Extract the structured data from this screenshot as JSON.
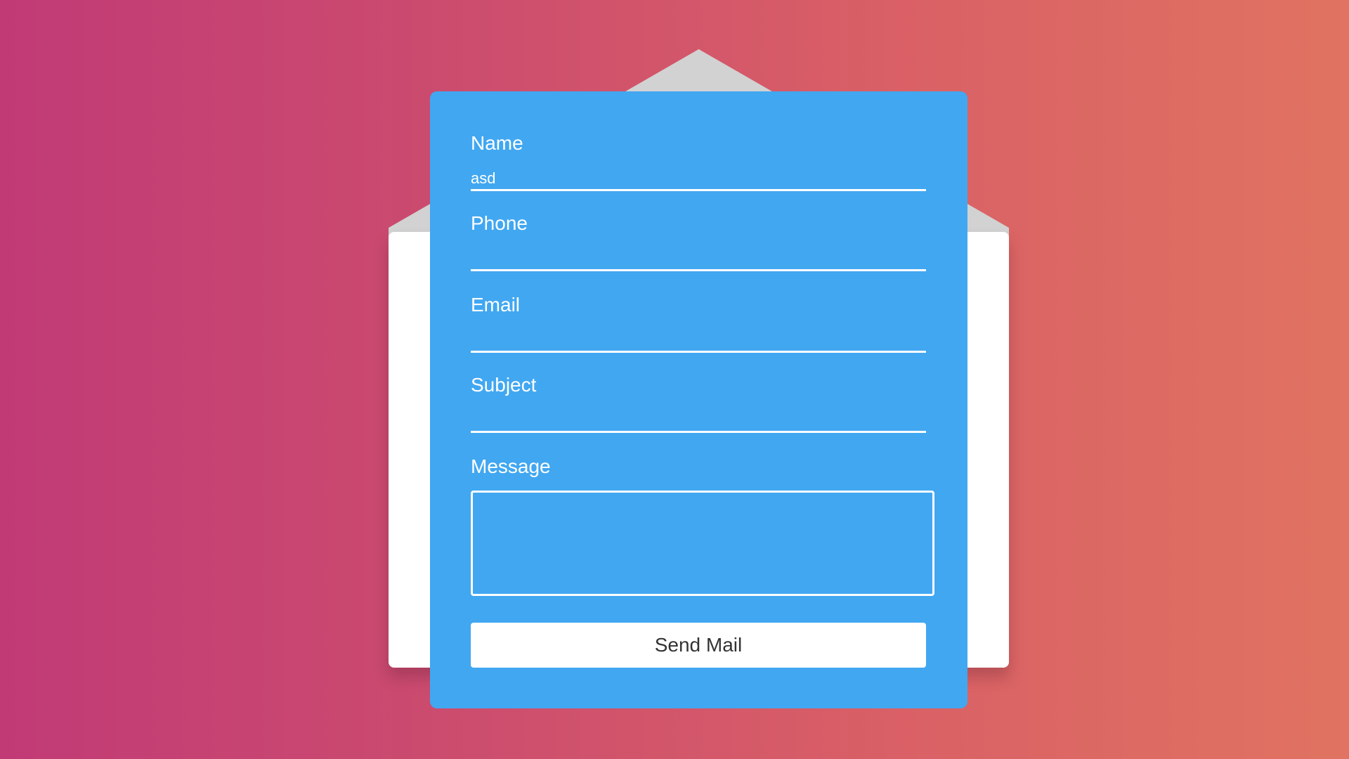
{
  "form": {
    "name_label": "Name",
    "name_value": "asd",
    "phone_label": "Phone",
    "phone_value": "",
    "email_label": "Email",
    "email_value": "",
    "subject_label": "Subject",
    "subject_value": "",
    "message_label": "Message",
    "message_value": "",
    "submit_label": "Send Mail"
  },
  "colors": {
    "background_gradient_start": "#c13a76",
    "background_gradient_end": "#e07361",
    "card": "#41a7f1",
    "envelope": "#ffffff",
    "envelope_flap": "#d2d2d2",
    "button": "#ffffff",
    "button_text": "#333333"
  }
}
